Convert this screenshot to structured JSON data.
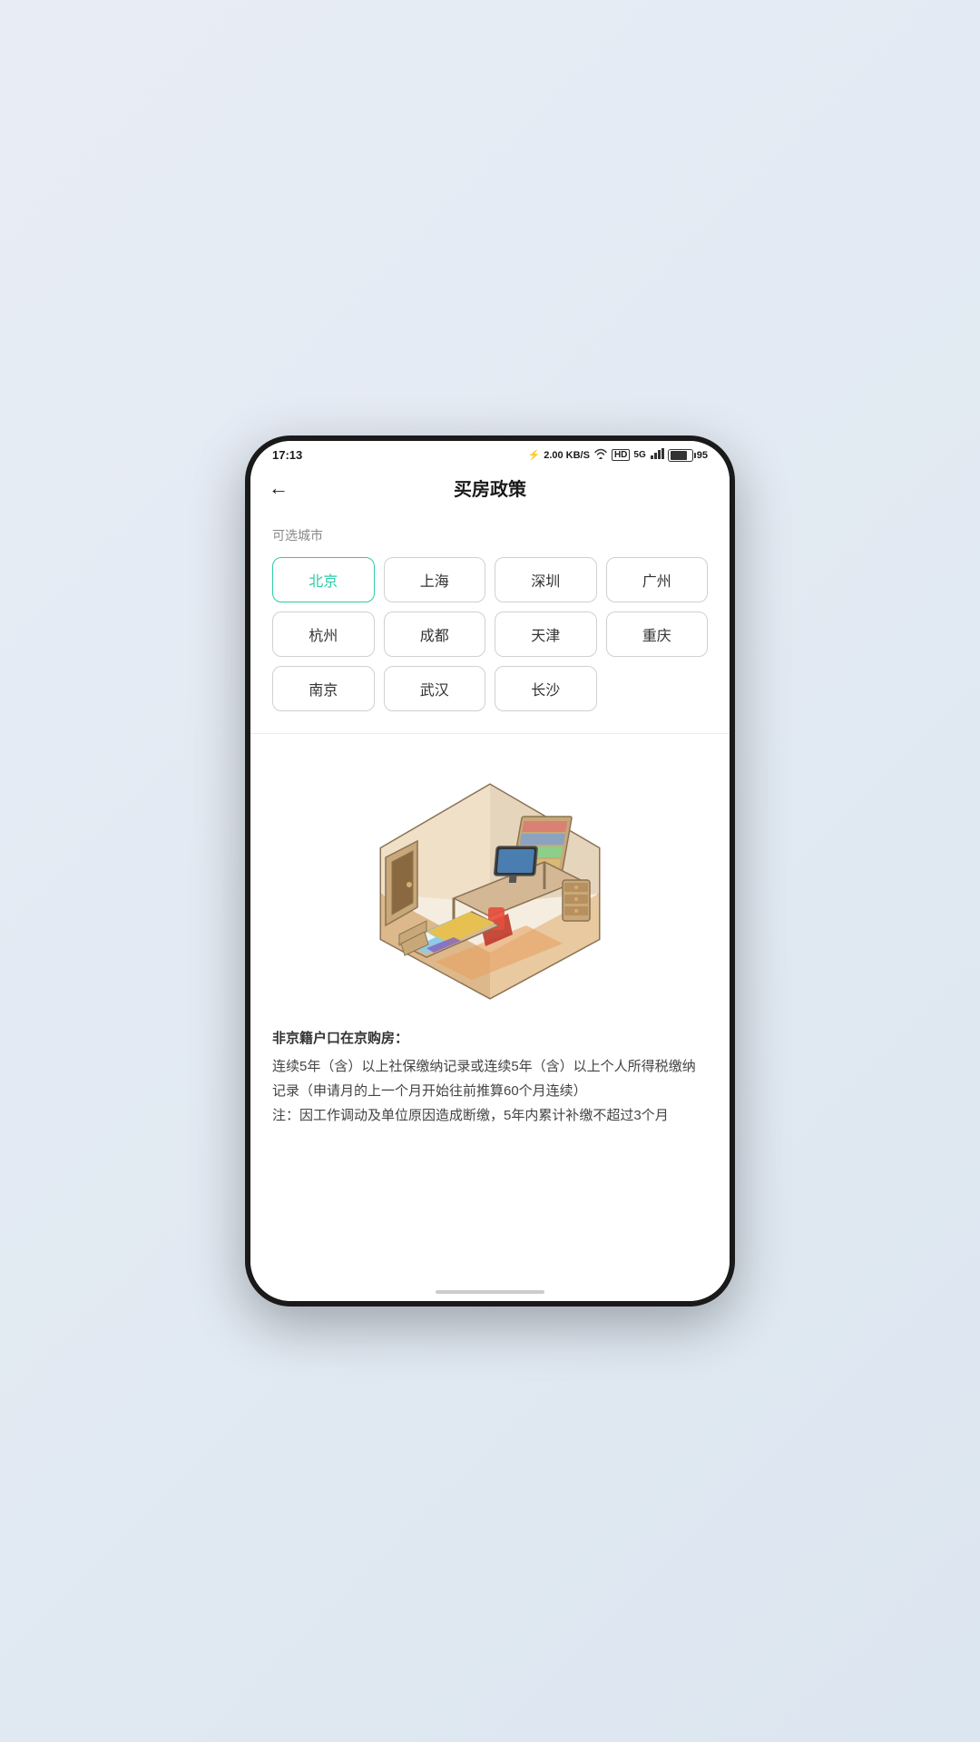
{
  "statusBar": {
    "time": "17:13",
    "bluetooth": "⚡",
    "network": "2.00 KB/S",
    "wifi": "WiFi",
    "hd": "HD",
    "signal": "5G",
    "battery": "95"
  },
  "header": {
    "backLabel": "←",
    "title": "买房政策"
  },
  "citySection": {
    "label": "可选城市",
    "cities": [
      {
        "name": "北京",
        "active": true
      },
      {
        "name": "上海",
        "active": false
      },
      {
        "name": "深圳",
        "active": false
      },
      {
        "name": "广州",
        "active": false
      },
      {
        "name": "杭州",
        "active": false
      },
      {
        "name": "成都",
        "active": false
      },
      {
        "name": "天津",
        "active": false
      },
      {
        "name": "重庆",
        "active": false
      },
      {
        "name": "南京",
        "active": false
      },
      {
        "name": "武汉",
        "active": false
      },
      {
        "name": "长沙",
        "active": false
      }
    ]
  },
  "policy": {
    "title": "非京籍户口在京购房：",
    "body": "连续5年（含）以上社保缴纳记录或连续5年（含）以上个人所得税缴纳记录（申请月的上一个月开始往前推算60个月连续）\n注：因工作调动及单位原因造成断缴，5年内累计补缴不超过3个月"
  }
}
